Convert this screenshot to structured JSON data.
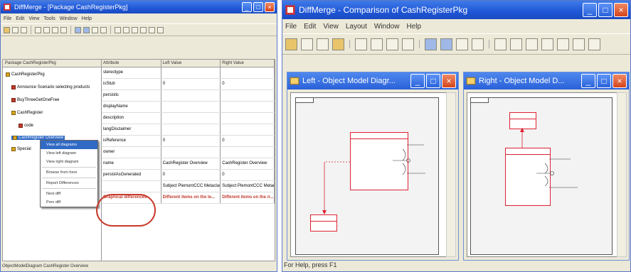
{
  "left_window": {
    "title": "DiffMerge - [Package CashRegisterPkg]",
    "menu": [
      "File",
      "Edit",
      "View",
      "Tools",
      "Window",
      "Help"
    ],
    "tree_header": "Package CashRegisterPkg",
    "tree_items": [
      {
        "label": "CashRegisterPkg"
      },
      {
        "label": "Announce Scenario selecting products"
      },
      {
        "label": "BuyThreeGetOneFree"
      },
      {
        "label": "CashRegister"
      },
      {
        "label": "code"
      },
      {
        "label": "CashRegister Overview"
      },
      {
        "label": "Special"
      }
    ],
    "grid_headers": [
      "Attribute",
      "Left Value",
      "Right Value"
    ],
    "grid_rows": [
      {
        "attr": "stereotype",
        "left": "",
        "right": ""
      },
      {
        "attr": "isStub",
        "left": "0",
        "right": "0"
      },
      {
        "attr": "persistic",
        "left": "",
        "right": ""
      },
      {
        "attr": "displayName",
        "left": "",
        "right": ""
      },
      {
        "attr": "description",
        "left": "",
        "right": ""
      },
      {
        "attr": "langDisclaimer",
        "left": "",
        "right": ""
      },
      {
        "attr": "isReference",
        "left": "0",
        "right": "0"
      },
      {
        "attr": "owner",
        "left": "",
        "right": ""
      },
      {
        "attr": "name",
        "left": "CashRegister Overview",
        "right": "CashRegister Overview"
      },
      {
        "attr": "persistAsGenerated",
        "left": "0",
        "right": "0"
      },
      {
        "attr": "",
        "left": "Subject PlemontCCC Metaclass...",
        "right": "Subject PlemontCCC Metaclass..."
      },
      {
        "attr": "Graphical differences",
        "left": "Different items on the le...",
        "right": "Different items on the ri..."
      }
    ],
    "context_menu": [
      "View all diagrams",
      "View left diagram",
      "View right diagram",
      "Browse from here",
      "Report Differences",
      "Next diff",
      "Prev diff"
    ],
    "status": "ObjectModelDiagram CashRegister Overview"
  },
  "right_window": {
    "title": "DiffMerge - Comparison of CashRegisterPkg",
    "menu": [
      "File",
      "Edit",
      "View",
      "Layout",
      "Window",
      "Help"
    ],
    "left_child_title": "Left - Object Model Diagr...",
    "right_child_title": "Right - Object Model D...",
    "status": "For Help, press F1"
  },
  "colors": {
    "title_blue": "#1f56d6",
    "highlight_red": "#c83a2a",
    "selection_blue": "#316ac5"
  }
}
